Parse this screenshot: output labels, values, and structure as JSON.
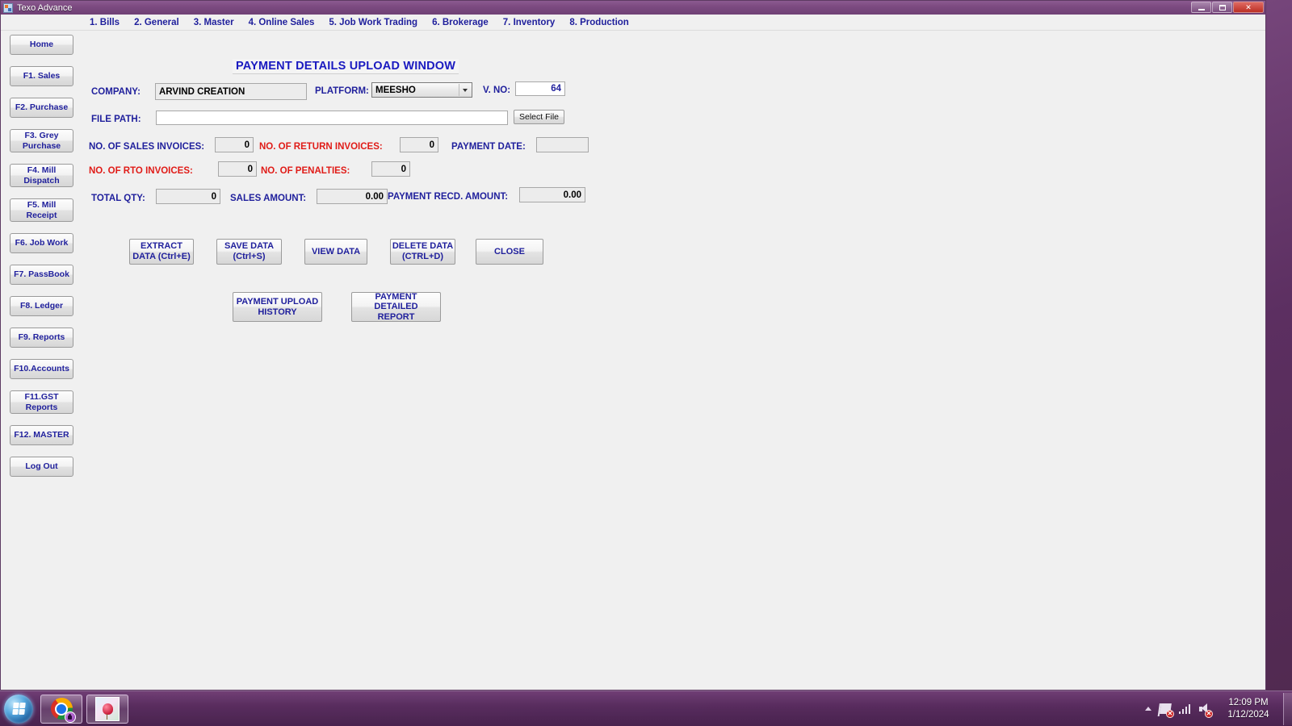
{
  "window": {
    "title": "Texo Advance",
    "app_icon": "app-icon",
    "minimize_label": "Minimize",
    "maximize_label": "Maximize",
    "close_label": "Close"
  },
  "menu": {
    "items": [
      {
        "label": "1. Bills"
      },
      {
        "label": "2. General"
      },
      {
        "label": "3. Master"
      },
      {
        "label": "4. Online Sales"
      },
      {
        "label": "5. Job Work Trading"
      },
      {
        "label": "6. Brokerage"
      },
      {
        "label": "7. Inventory"
      },
      {
        "label": "8. Production"
      }
    ]
  },
  "sidebar": {
    "items": [
      {
        "label": "Home",
        "lines": 1
      },
      {
        "label": "F1. Sales",
        "lines": 1
      },
      {
        "label": "F2. Purchase",
        "lines": 1
      },
      {
        "label": "F3. Grey Purchase",
        "lines": 2
      },
      {
        "label": "F4. Mill Dispatch",
        "lines": 2
      },
      {
        "label": "F5. Mill Receipt",
        "lines": 2
      },
      {
        "label": "F6. Job Work",
        "lines": 1
      },
      {
        "label": "F7. PassBook",
        "lines": 1
      },
      {
        "label": "F8. Ledger",
        "lines": 1
      },
      {
        "label": "F9. Reports",
        "lines": 1
      },
      {
        "label": "F10.Accounts",
        "lines": 1
      },
      {
        "label": "F11.GST Reports",
        "lines": 2
      },
      {
        "label": "F12. MASTER",
        "lines": 1
      },
      {
        "label": "Log Out",
        "lines": 1
      }
    ]
  },
  "form": {
    "title": "PAYMENT DETAILS UPLOAD WINDOW",
    "company": {
      "label": "COMPANY:",
      "value": "ARVIND CREATION"
    },
    "platform": {
      "label": "PLATFORM:",
      "value": "MEESHO",
      "options": [
        "MEESHO"
      ]
    },
    "v_no": {
      "label": "V. NO:",
      "value": "64"
    },
    "file_path": {
      "label": "FILE PATH:",
      "value": "",
      "placeholder": ""
    },
    "select_file_button": "Select  File",
    "no_of_sales_invoices": {
      "label": "NO. OF SALES INVOICES:",
      "value": "0"
    },
    "no_of_return_invoices": {
      "label": "NO. OF RETURN INVOICES:",
      "value": "0"
    },
    "payment_date": {
      "label": "PAYMENT DATE:",
      "value": ""
    },
    "no_of_rto_invoices": {
      "label": "NO. OF RTO INVOICES:",
      "value": "0"
    },
    "no_of_penalties": {
      "label": "NO. OF PENALTIES:",
      "value": "0"
    },
    "total_qty": {
      "label": "TOTAL QTY:",
      "value": "0"
    },
    "sales_amount": {
      "label": "SALES AMOUNT:",
      "value": "0.00"
    },
    "payment_recd_amount": {
      "label": "PAYMENT RECD. AMOUNT:",
      "value": "0.00"
    },
    "actions": {
      "extract_data": "EXTRACT\nDATA (Ctrl+E)",
      "extract_data_l1": "EXTRACT",
      "extract_data_l2": "DATA (Ctrl+E)",
      "save_data_l1": "SAVE DATA",
      "save_data_l2": "(Ctrl+S)",
      "view_data": "VIEW DATA",
      "delete_data_l1": "DELETE DATA",
      "delete_data_l2": "(CTRL+D)",
      "close": "CLOSE",
      "payment_upload_history_l1": "PAYMENT UPLOAD",
      "payment_upload_history_l2": "HISTORY",
      "payment_detailed_report_l1": "PAYMENT DETAILED",
      "payment_detailed_report_l2": "REPORT"
    }
  },
  "taskbar": {
    "start_label": "Start",
    "items": [
      {
        "name": "chrome",
        "label": "Google Chrome"
      },
      {
        "name": "app2",
        "label": "Application"
      }
    ],
    "tray": {
      "show_hidden_label": "Show hidden icons",
      "network_label": "Network - not connected",
      "signal_label": "Signal",
      "volume_label": "Volume - muted"
    },
    "clock": {
      "time": "12:09 PM",
      "date": "1/12/2024"
    },
    "show_desktop_label": "Show desktop"
  },
  "colors": {
    "accent_blue": "#1f1f9c",
    "alert_red": "#e01b17",
    "form_bg": "#f0f0f0",
    "taskbar": "#5e3163"
  }
}
